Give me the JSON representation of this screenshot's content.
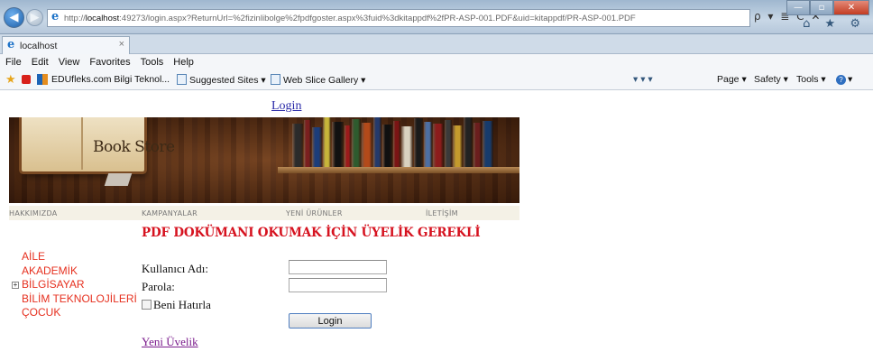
{
  "browser": {
    "url_prefix": "http://",
    "url_host": "localhost",
    "url_rest": ":49273/login.aspx?ReturnUrl=%2fizinlibolge%2fpdfgoster.aspx%3fuid%3dkitappdf%2fPR-ASP-001.PDF&uid=kitappdf/PR-ASP-001.PDF",
    "address_tools": "ρ ▾ ≣ C ✕",
    "tab_title": "localhost",
    "tab_close": "×",
    "menu": [
      "File",
      "Edit",
      "View",
      "Favorites",
      "Tools",
      "Help"
    ],
    "favorites": {
      "edufleks": "EDUfleks.com Bilgi Teknol...",
      "suggested": "Suggested Sites ▾",
      "webslice": "Web Slice Gallery ▾"
    },
    "command_bar": {
      "icons": "▾   ▾  ▾",
      "page": "Page ▾",
      "safety": "Safety ▾",
      "tools": "Tools ▾",
      "help": "▾"
    },
    "window_controls": {
      "minimize": "—",
      "maximize": "▫",
      "close": "✕"
    },
    "toolbar_icons": "⌂ ★ ⚙"
  },
  "page": {
    "login_link": "Login",
    "banner_title": "Book Store",
    "nav": [
      "HAKKIMIZDA",
      "KAMPANYALAR",
      "YENİ ÜRÜNLER",
      "İLETİŞİM"
    ],
    "heading": "PDF DOKÜMANI OKUMAK İÇİN ÜYELİK GEREKLİ",
    "categories": [
      "AİLE",
      "AKADEMİK",
      "BİLGİSAYAR",
      "BİLİM TEKNOLOJİLERİ",
      "ÇOCUK"
    ],
    "expander": "+",
    "form": {
      "username_label": "Kullanıcı Adı:",
      "username_value": "",
      "password_label": "Parola:",
      "password_value": "",
      "remember_label": "Beni Hatırla",
      "remember_checked": false,
      "login_button": "Login"
    },
    "register_link": "Yeni Üvelik"
  },
  "colors": {
    "heading": "#d6121f",
    "category": "#e6301f",
    "link": "#2a2aa8",
    "visited_link": "#7a1a8c",
    "button_border": "#4f7ec0"
  },
  "banner_book_colors": [
    "#2b2b2b",
    "#7a1f1f",
    "#1c3d7a",
    "#c7b53a",
    "#111111",
    "#9b1b1b",
    "#2e5b2e",
    "#b34a1a",
    "#243a6b",
    "#101010",
    "#7b1414",
    "#d9d2c0",
    "#1a1a1a",
    "#4d6fa3",
    "#8c1c1c",
    "#3a3a3a",
    "#c49a2d",
    "#222222",
    "#6b1e1e",
    "#173b6c"
  ]
}
